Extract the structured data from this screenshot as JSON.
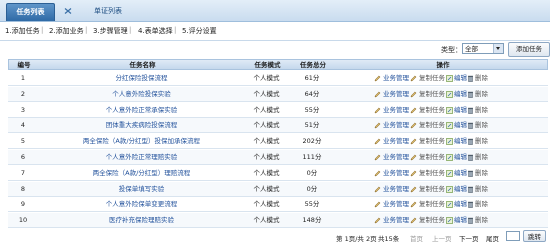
{
  "tabs": {
    "active": "任务列表",
    "inactive": "单证列表"
  },
  "steps": [
    "1.添加任务",
    "2.添加业务",
    "3.步骤管理",
    "4.表单选择",
    "5.评分设置"
  ],
  "filter": {
    "type_label": "类型：",
    "type_value": "全部",
    "add_button": "添加任务"
  },
  "table": {
    "headers": [
      "编号",
      "任务名称",
      "任务模式",
      "任务总分",
      "操作"
    ],
    "ops": {
      "business": "业务管理",
      "copy": "复制任务",
      "edit": "编辑",
      "delete": "删除"
    },
    "rows": [
      {
        "num": "1",
        "name": "分红保险投保流程",
        "mode": "个人模式",
        "score": "61分"
      },
      {
        "num": "2",
        "name": "个人意外险投保实验",
        "mode": "个人模式",
        "score": "64分"
      },
      {
        "num": "3",
        "name": "个人意外险正常承保实验",
        "mode": "个人模式",
        "score": "55分"
      },
      {
        "num": "4",
        "name": "团体重大疾病险投保流程",
        "mode": "个人模式",
        "score": "51分"
      },
      {
        "num": "5",
        "name": "两全保险（A款/分红型）投保加承保流程",
        "mode": "个人模式",
        "score": "202分"
      },
      {
        "num": "6",
        "name": "个人意外险正常理赔实验",
        "mode": "个人模式",
        "score": "111分"
      },
      {
        "num": "7",
        "name": "两全保险（A款/分红型）理赔流程",
        "mode": "个人模式",
        "score": "0分"
      },
      {
        "num": "8",
        "name": "投保单填写实验",
        "mode": "个人模式",
        "score": "0分"
      },
      {
        "num": "9",
        "name": "个人意外险保单变更流程",
        "mode": "个人模式",
        "score": "55分"
      },
      {
        "num": "10",
        "name": "医疗补充保险理赔实验",
        "mode": "个人模式",
        "score": "148分"
      }
    ]
  },
  "pager": {
    "page_info": "第 1页/共 2页",
    "total": "共15条",
    "first": "首页",
    "prev": "上一页",
    "next": "下一页",
    "last": "尾页",
    "go": "跳转"
  }
}
